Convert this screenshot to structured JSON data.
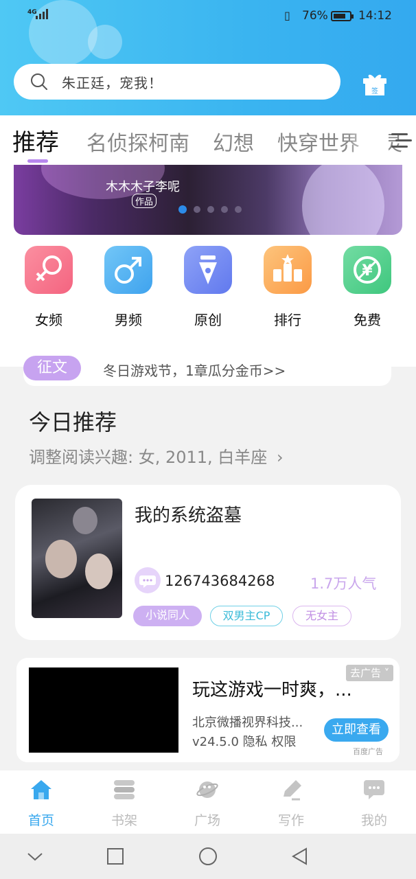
{
  "status_bar": {
    "network": "4G",
    "battery_pct": "76%",
    "battery_level": 0.76,
    "time": "14:12"
  },
  "search": {
    "placeholder": "朱正廷，宠我！"
  },
  "header": {
    "gift_icon": "gift-checkin-icon",
    "gift_label": "签"
  },
  "tabs": [
    {
      "label": "推荐",
      "active": true
    },
    {
      "label": "名侦探柯南"
    },
    {
      "label": "幻想"
    },
    {
      "label": "快穿世界"
    },
    {
      "label": "灵"
    }
  ],
  "banner": {
    "author": "木木木子李呢",
    "tag": "作品"
  },
  "categories": [
    {
      "label": "女频",
      "icon": "female-icon",
      "color": "#f56e86"
    },
    {
      "label": "男频",
      "icon": "male-icon",
      "color": "#45a9ef"
    },
    {
      "label": "原创",
      "icon": "pen-nib-icon",
      "color": "#6f87f2"
    },
    {
      "label": "排行",
      "icon": "ranking-icon",
      "color": "#fba24e"
    },
    {
      "label": "免费",
      "icon": "free-yen-icon",
      "color": "#47cc86"
    }
  ],
  "notice": {
    "badge": "征文",
    "text": "冬日游戏节，1章瓜分金币>>"
  },
  "recommend": {
    "title": "今日推荐",
    "subtitle": "调整阅读兴趣: 女, 2011, 白羊座",
    "book": {
      "title": "我的系统盗墓",
      "author": "126743684268",
      "popularity": "1.7万人气",
      "tags": [
        "小说同人",
        "双男主CP",
        "无女主"
      ]
    }
  },
  "ad": {
    "title": "玩这游戏一时爽，...",
    "close": "去广告",
    "company": "北京微播视界科技...",
    "meta": "v24.5.0 隐私 权限",
    "button": "立即查看",
    "source": "百度广告"
  },
  "bottom_nav": [
    {
      "label": "首页",
      "icon": "home-icon",
      "active": true
    },
    {
      "label": "书架",
      "icon": "bookshelf-icon"
    },
    {
      "label": "广场",
      "icon": "planet-icon"
    },
    {
      "label": "写作",
      "icon": "write-pencil-icon"
    },
    {
      "label": "我的",
      "icon": "chat-bubble-icon"
    }
  ],
  "colors": {
    "accent": "#39a8ee",
    "purple": "#c7a3f0"
  }
}
